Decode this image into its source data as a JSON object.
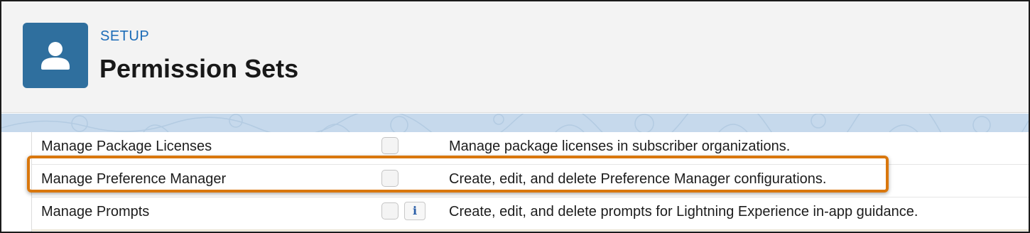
{
  "header": {
    "eyebrow": "SETUP",
    "title": "Permission Sets",
    "icon": "user-icon"
  },
  "permissions": [
    {
      "name": "Manage Package Licenses",
      "enabled": false,
      "has_info": false,
      "description": "Manage package licenses in subscriber organizations."
    },
    {
      "name": "Manage Preference Manager",
      "enabled": false,
      "has_info": false,
      "highlighted": true,
      "description": "Create, edit, and delete Preference Manager configurations."
    },
    {
      "name": "Manage Prompts",
      "enabled": false,
      "has_info": true,
      "info_glyph": "i",
      "description": "Create, edit, and delete prompts for Lightning Experience in-app guidance."
    }
  ],
  "colors": {
    "icon_bg": "#2f6f9e",
    "eyebrow": "#1b6bb7",
    "highlight": "#d9770d",
    "band": "#c6d9ec"
  }
}
